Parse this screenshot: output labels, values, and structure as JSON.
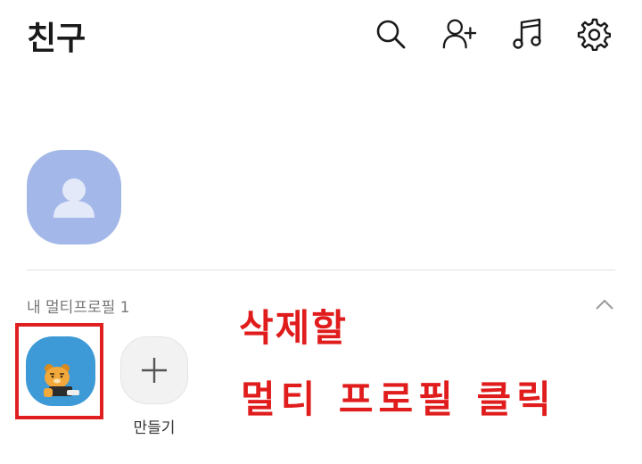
{
  "header": {
    "title": "친구",
    "icons": [
      "search-icon",
      "add-friend-icon",
      "music-icon",
      "settings-icon"
    ]
  },
  "my_profile": {
    "avatar_color": "#a3b7e8"
  },
  "multi_profile": {
    "section_label": "내 멀티프로필 1",
    "profiles": [
      {
        "avatar_color": "#3d9ad6",
        "icon": "bear-character-icon"
      }
    ],
    "create_label": "만들기"
  },
  "annotation": {
    "line1": "삭제할",
    "line2": "멀티 프로필 클릭",
    "color": "#e01c1c"
  }
}
